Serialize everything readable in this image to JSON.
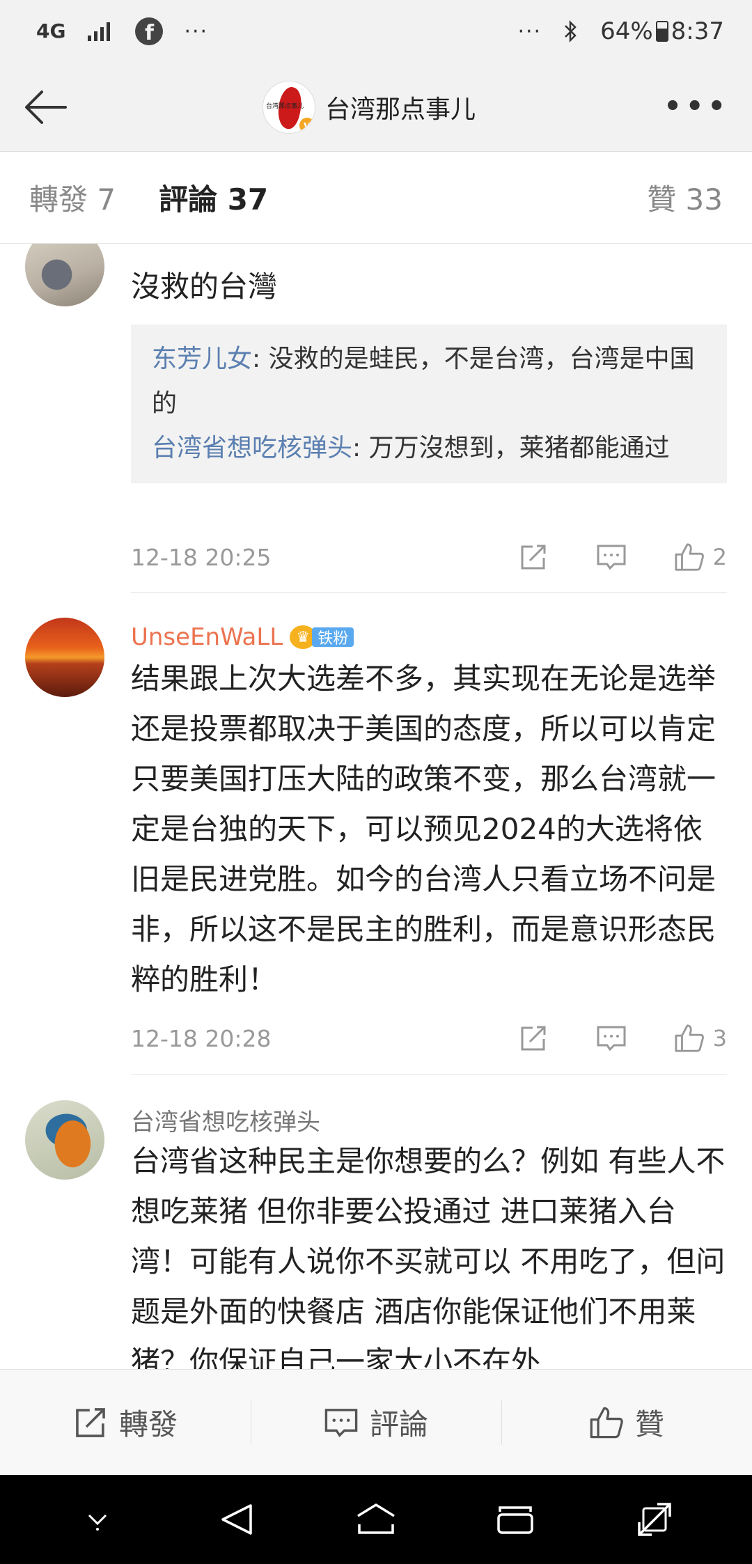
{
  "status_bar": {
    "network": "4G",
    "overflow": "···",
    "right_overflow": "···",
    "battery": "64%",
    "time": "8:37"
  },
  "nav": {
    "title": "台湾那点事儿",
    "logo_text": "台湾那点事儿",
    "more": "•••"
  },
  "tabs": {
    "repost": "轉發 7",
    "comments": "評論 37",
    "likes": "贊 33"
  },
  "comments": [
    {
      "username": "",
      "text": "沒救的台灣",
      "replies": [
        {
          "name": "东芳儿女",
          "text": ": 没救的是蛙民，不是台湾，台湾是中国的"
        },
        {
          "name": "台湾省想吃核弹头",
          "text": ": 万万沒想到，莱猪都能通过"
        }
      ],
      "time": "12-18 20:25",
      "likes": "2"
    },
    {
      "username": "UnseEnWaLL",
      "badge": "铁粉",
      "text": "结果跟上次大选差不多，其实现在无论是选举还是投票都取决于美国的态度，所以可以肯定只要美国打压大陆的政策不变，那么台湾就一定是台独的天下，可以预见2024的大选将依旧是民进党胜。如今的台湾人只看立场不问是非，所以这不是民主的胜利，而是意识形态民粹的胜利！",
      "time": "12-18 20:28",
      "likes": "3"
    },
    {
      "username": "台湾省想吃核弹头",
      "text": "台湾省这种民主是你想要的么？例如 有些人不想吃莱猪 但你非要公投通过 进口莱猪入台湾！可能有人说你不买就可以 不用吃了，但问题是外面的快餐店 酒店你能保证他们不用莱猪？你保证自己一家大小不在外"
    }
  ],
  "action_bar": {
    "repost": "轉發",
    "comment": "評論",
    "like": "贊"
  },
  "colors": {
    "accent_orange": "#eb7350",
    "reply_name_blue": "#5b7fb0",
    "badge_blue": "#5aa9ef"
  }
}
